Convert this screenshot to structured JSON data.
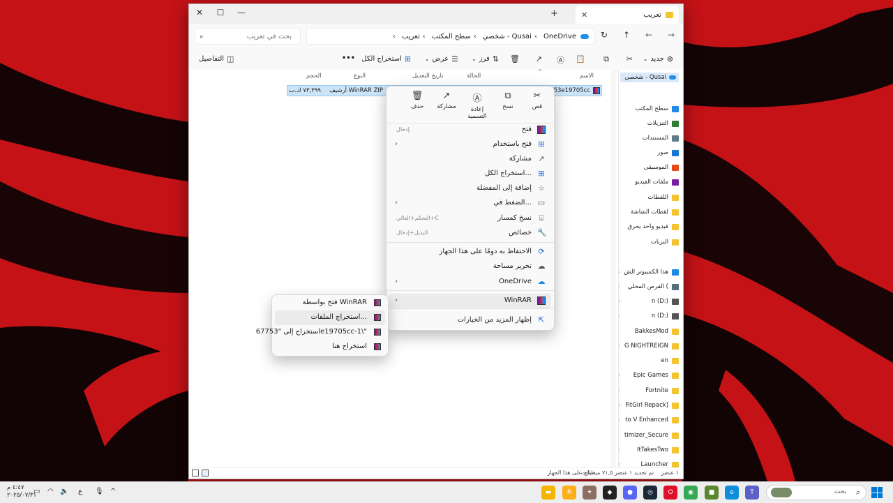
{
  "window": {
    "tab_title": "تعريب",
    "new_tab": "+",
    "tab_close": "✕",
    "minimize": "—",
    "maximize": "☐",
    "close": "✕"
  },
  "address": {
    "breadcrumbs": [
      "OneDrive",
      "شخصي - Qusai",
      "سطح المكتب",
      "تعريب"
    ],
    "search_placeholder": "بحث في تعريب"
  },
  "toolbar": {
    "new_label": "جديد",
    "sort_label": "فرز",
    "view_label": "عرض",
    "extract_all_label": "استخراج الكل",
    "more": "•••",
    "details_label": "التفاصيل"
  },
  "columns": {
    "name": "الاسم",
    "status": "الحالة",
    "modified": "تاريخ التعديل",
    "type": "النوع",
    "size": "الحجم"
  },
  "file": {
    "name": "67753e19705cc",
    "type": "أرشيف WinRAR ZIP",
    "size": "٧٣,٣٩٩ ك.ب"
  },
  "navpane": {
    "home": "شخصي - Qusai",
    "items": [
      {
        "label": "سطح المكتب",
        "color": "#1e88e5",
        "chevron": false
      },
      {
        "label": "التنزيلات",
        "color": "#2e7d32",
        "chevron": false
      },
      {
        "label": "المستندات",
        "color": "#607d8b",
        "chevron": false
      },
      {
        "label": "صور",
        "color": "#1976d2",
        "chevron": false
      },
      {
        "label": "الموسيقى",
        "color": "#e64a19",
        "chevron": false
      },
      {
        "label": "ملفات الفيديو",
        "color": "#7b1fa2",
        "chevron": false
      },
      {
        "label": "اللقطات",
        "color": "#f4c430",
        "chevron": false
      },
      {
        "label": "لقطات الشاشة",
        "color": "#f4c430",
        "chevron": false
      },
      {
        "label": "فيديو واحد يحرق",
        "color": "#f4c430",
        "chevron": false
      },
      {
        "label": "البرنات",
        "color": "#f4c430",
        "chevron": false
      },
      {
        "label": "هذا الكمبيوتر الش",
        "color": "#1e88e5",
        "chevron": true
      },
      {
        "label": "القرص المحلي (",
        "color": "#546e7a",
        "chevron": true
      },
      {
        "label": "n (D:)",
        "color": "#555555",
        "chevron": true
      },
      {
        "label": "n (D:)",
        "color": "#555555",
        "chevron": true
      },
      {
        "label": "BakkesMod",
        "color": "#f4c430",
        "chevron": false
      },
      {
        "label": "G NIGHTREIGN",
        "color": "#f4c430",
        "chevron": true
      },
      {
        "label": "en",
        "color": "#f4c430",
        "chevron": false
      },
      {
        "label": "Epic Games",
        "color": "#f4c430",
        "chevron": true
      },
      {
        "label": "Fortnite",
        "color": "#f4c430",
        "chevron": true
      },
      {
        "label": "FitGirl Repack]",
        "color": "#f4c430",
        "chevron": true
      },
      {
        "label": "to V Enhanced",
        "color": "#f4c430",
        "chevron": true
      },
      {
        "label": "timizer_Secure",
        "color": "#f4c430",
        "chevron": false
      },
      {
        "label": "ItTakesTwo",
        "color": "#f4c430",
        "chevron": true
      },
      {
        "label": "Launcher",
        "color": "#f4c430",
        "chevron": true
      }
    ]
  },
  "context_menu": {
    "quick_actions": [
      {
        "label": "قص",
        "icon": "scissors-icon",
        "glyph": "✂"
      },
      {
        "label": "نسخ",
        "icon": "copy-icon",
        "glyph": "⧉"
      },
      {
        "label": "إعادة التسمية",
        "icon": "rename-icon",
        "glyph": "Ⓐ"
      },
      {
        "label": "مشاركة",
        "icon": "share-icon",
        "glyph": "↗"
      },
      {
        "label": "حذف",
        "icon": "trash-icon",
        "glyph": "🗑"
      }
    ],
    "items": [
      {
        "label": "فتح",
        "key": "إدخال",
        "chevron": false,
        "glyph": "▦"
      },
      {
        "label": "فتح باستخدام",
        "key": "",
        "chevron": true,
        "glyph": "⊞"
      },
      {
        "label": "مشاركة",
        "key": "",
        "chevron": false,
        "glyph": "↗"
      },
      {
        "label": "استخراج الكل...",
        "key": "",
        "chevron": false,
        "glyph": "⊞"
      },
      {
        "label": "إضافة إلى المفضلة",
        "key": "",
        "chevron": false,
        "glyph": "☆"
      },
      {
        "label": "الضغط في...",
        "key": "",
        "chevron": true,
        "glyph": "▭"
      },
      {
        "label": "نسخ كمسار",
        "key": "التحكم+العالي+C",
        "chevron": false,
        "glyph": "⌸"
      },
      {
        "label": "خصائص",
        "key": "البديل+إدخال",
        "chevron": false,
        "glyph": "🔧"
      },
      {
        "label": "الاحتفاظ به دومًا على هذا الجهاز",
        "key": "",
        "chevron": false,
        "glyph": "⟳"
      },
      {
        "label": "تحرير مساحة",
        "key": "",
        "chevron": false,
        "glyph": "☁"
      },
      {
        "label": "OneDrive",
        "key": "",
        "chevron": true,
        "glyph": "☁"
      },
      {
        "label": "WinRAR",
        "key": "",
        "chevron": true,
        "glyph": "▦"
      },
      {
        "label": "إظهار المزيد من الخيارات",
        "key": "",
        "chevron": false,
        "glyph": "⇱"
      }
    ]
  },
  "submenu": {
    "items": [
      {
        "label": "فتح بواسطة WinRAR"
      },
      {
        "label": "استخراج الملفات..."
      },
      {
        "label": "استخراج إلى \"67753e19705cc-1\\\""
      },
      {
        "label": "استخراج هنا"
      }
    ]
  },
  "statusbar": {
    "count": "١ عنصر",
    "selected": "تم تحديد ١ عنصر ٧١,٥ ميغابايت",
    "availability": "متاح على هذا الجهاز"
  },
  "taskbar": {
    "search_label": "بحث",
    "time": "٤:٤٧ م",
    "date": "٢٠٢٥/٠٧/٣١",
    "lang": "ع",
    "apps": [
      {
        "name": "file-explorer-icon",
        "color": "#f4b400",
        "glyph": "▬"
      },
      {
        "name": "rockstar-icon",
        "color": "#fcaf17",
        "glyph": "R"
      },
      {
        "name": "game-icon",
        "color": "#8d6e63",
        "glyph": "✦"
      },
      {
        "name": "epic-icon",
        "color": "#222222",
        "glyph": "◆"
      },
      {
        "name": "discord-icon",
        "color": "#5865f2",
        "glyph": "●"
      },
      {
        "name": "steam-icon",
        "color": "#1b2838",
        "glyph": "◎"
      },
      {
        "name": "opera-icon",
        "color": "#e0102b",
        "glyph": "O"
      },
      {
        "name": "chrome-icon",
        "color": "#34a853",
        "glyph": "◉"
      },
      {
        "name": "minecraft-icon",
        "color": "#5b8731",
        "glyph": "■"
      },
      {
        "name": "edge-icon",
        "color": "#0c8ed9",
        "glyph": "e"
      },
      {
        "name": "teams-icon",
        "color": "#5b5fc7",
        "glyph": "T"
      }
    ]
  }
}
